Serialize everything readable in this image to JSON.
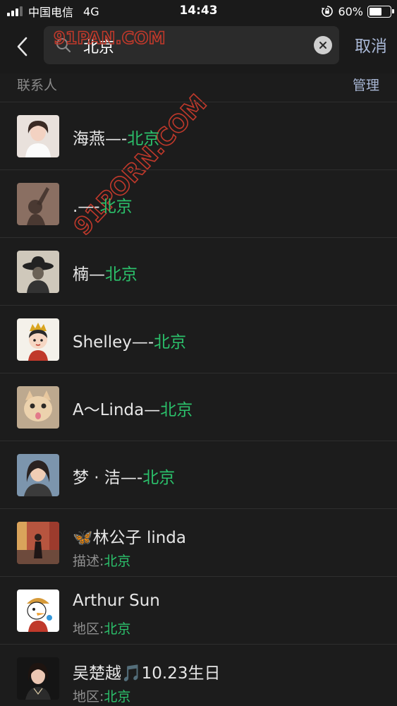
{
  "status_bar": {
    "carrier": "中国电信",
    "network": "4G",
    "time": "14:43",
    "battery": "60%",
    "battery_level": 0.6
  },
  "search": {
    "query": "北京",
    "cancel_label": "取消"
  },
  "watermark": {
    "text_top": "91PAN.COM",
    "text_diagonal": "91PORN.COM",
    "color": "#c0392b"
  },
  "section": {
    "title": "联系人",
    "manage_label": "管理"
  },
  "highlight_color": "#2bc16b",
  "contacts": [
    {
      "prefix": "海燕—-",
      "highlight": "北京",
      "avatar_icon": "girl-portrait-avatar"
    },
    {
      "prefix": ".—-",
      "highlight": "北京",
      "avatar_icon": "shadow-hand-avatar"
    },
    {
      "prefix": "楠—",
      "highlight": "北京",
      "avatar_icon": "hat-sketch-avatar"
    },
    {
      "prefix": "Shelley—-",
      "highlight": "北京",
      "avatar_icon": "cartoon-queen-avatar"
    },
    {
      "prefix": "A～Linda—",
      "highlight": "北京",
      "avatar_icon": "cat-avatar"
    },
    {
      "prefix": "梦 · 洁—-",
      "highlight": "北京",
      "avatar_icon": "woman-selfie-avatar"
    },
    {
      "name": "林公子 linda",
      "name_icon": "butterfly-icon",
      "sub_label": "描述:",
      "sub_highlight": "北京",
      "avatar_icon": "street-scene-avatar"
    },
    {
      "name": "Arthur Sun",
      "sub_label": "地区:",
      "sub_highlight": "北京",
      "avatar_icon": "cartoon-duck-avatar"
    },
    {
      "name": "吴楚越",
      "name_icon": "music-note-icon",
      "name_suffix": "10.23生日",
      "sub_label": "地区:",
      "sub_highlight": "北京",
      "avatar_icon": "woman-portrait-avatar"
    }
  ]
}
